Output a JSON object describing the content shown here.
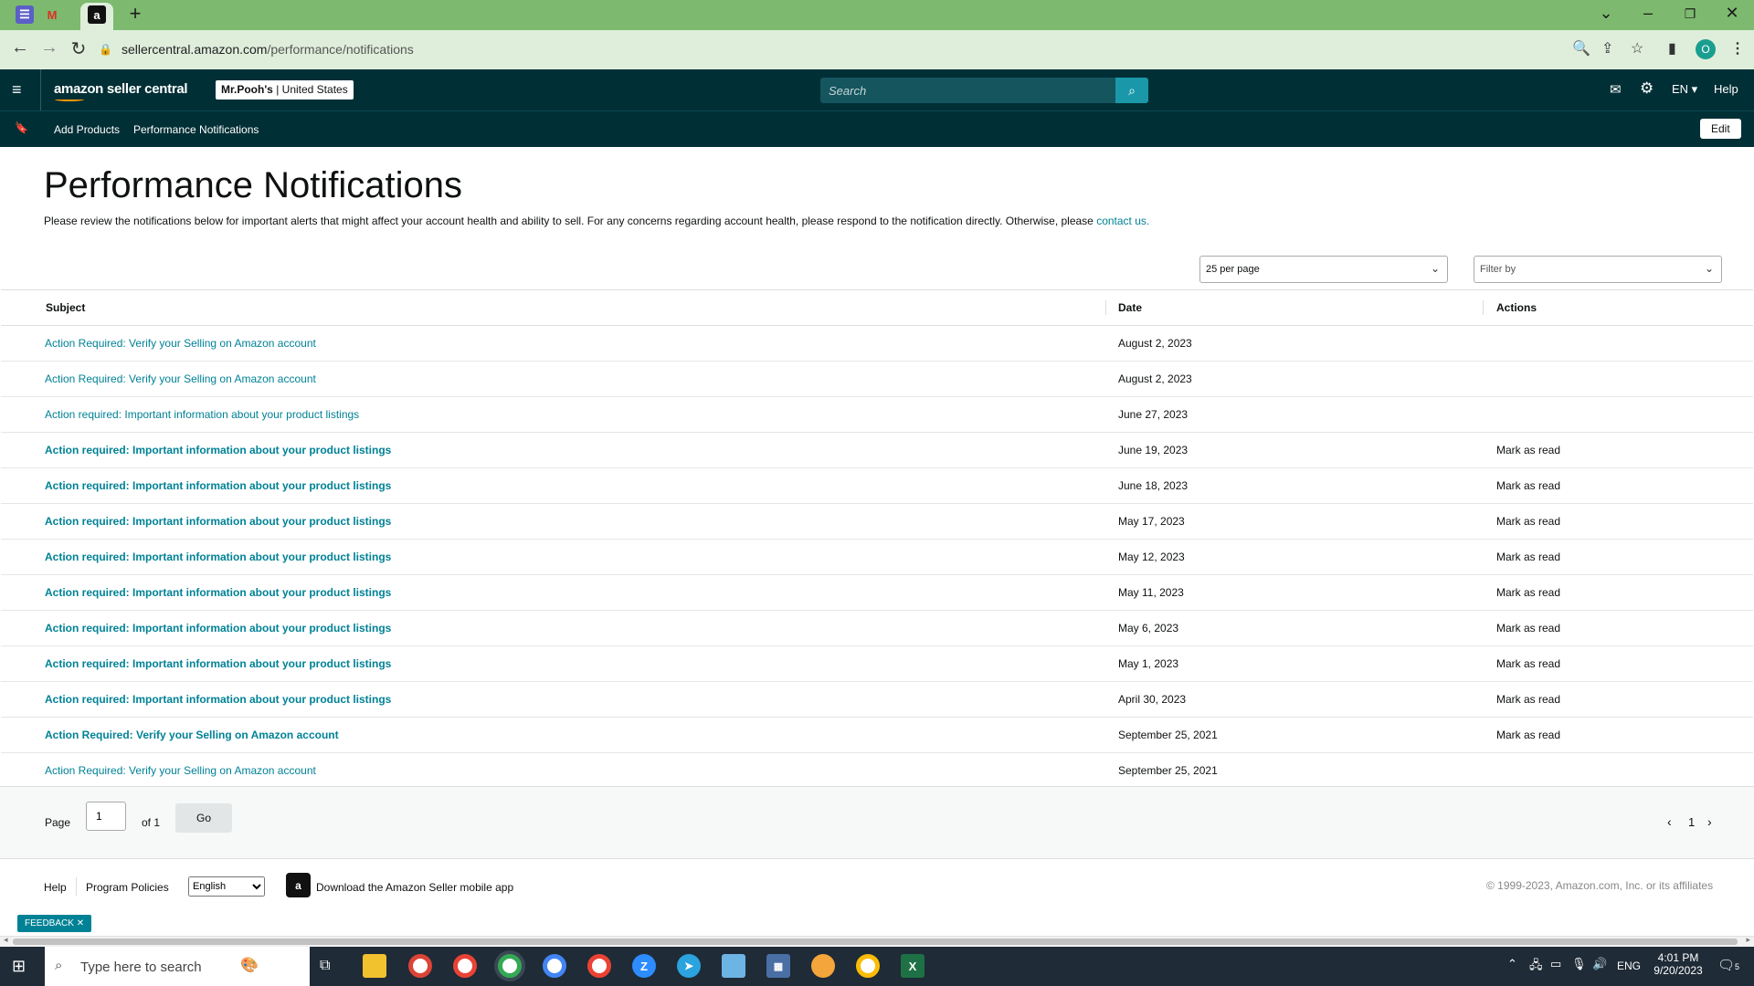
{
  "browser": {
    "url_domain": "sellercentral.amazon.com",
    "url_path": "/performance/notifications",
    "profile_initial": "O"
  },
  "header": {
    "logo_text": "amazon seller central",
    "store_name": "Mr.Pooh's",
    "store_region": "United States",
    "search_placeholder": "Search",
    "language": "EN",
    "help": "Help"
  },
  "subnav": {
    "items": [
      "Add Products",
      "Performance Notifications"
    ],
    "edit": "Edit"
  },
  "page": {
    "title": "Performance Notifications",
    "description": "Please review the notifications below for important alerts that might affect your account health and ability to sell. For any concerns regarding account health, please respond to the notification directly. Otherwise, please",
    "contact_link": "contact us.",
    "per_page": "25 per page",
    "filter_by": "Filter by"
  },
  "table": {
    "headers": [
      "Subject",
      "Date",
      "Actions"
    ],
    "rows": [
      {
        "subject": "Action Required: Verify your Selling on Amazon account",
        "date": "August 2, 2023",
        "action": "",
        "bold": false
      },
      {
        "subject": "Action Required: Verify your Selling on Amazon account",
        "date": "August 2, 2023",
        "action": "",
        "bold": false
      },
      {
        "subject": "Action required: Important information about your product listings",
        "date": "June 27, 2023",
        "action": "",
        "bold": false
      },
      {
        "subject": "Action required: Important information about your product listings",
        "date": "June 19, 2023",
        "action": "Mark as read",
        "bold": true
      },
      {
        "subject": "Action required: Important information about your product listings",
        "date": "June 18, 2023",
        "action": "Mark as read",
        "bold": true
      },
      {
        "subject": "Action required: Important information about your product listings",
        "date": "May 17, 2023",
        "action": "Mark as read",
        "bold": true
      },
      {
        "subject": "Action required: Important information about your product listings",
        "date": "May 12, 2023",
        "action": "Mark as read",
        "bold": true
      },
      {
        "subject": "Action required: Important information about your product listings",
        "date": "May 11, 2023",
        "action": "Mark as read",
        "bold": true
      },
      {
        "subject": "Action required: Important information about your product listings",
        "date": "May 6, 2023",
        "action": "Mark as read",
        "bold": true
      },
      {
        "subject": "Action required: Important information about your product listings",
        "date": "May 1, 2023",
        "action": "Mark as read",
        "bold": true
      },
      {
        "subject": "Action required: Important information about your product listings",
        "date": "April 30, 2023",
        "action": "Mark as read",
        "bold": true
      },
      {
        "subject": "Action Required: Verify your Selling on Amazon account",
        "date": "September 25, 2021",
        "action": "Mark as read",
        "bold": true
      },
      {
        "subject": "Action Required: Verify your Selling on Amazon account",
        "date": "September 25, 2021",
        "action": "",
        "bold": false
      }
    ]
  },
  "pager": {
    "page_label": "Page",
    "page_value": "1",
    "of_label": "of 1",
    "go": "Go",
    "current": "1"
  },
  "footer": {
    "help": "Help",
    "program_policies": "Program Policies",
    "language": "English",
    "download_app": "Download the Amazon Seller mobile app",
    "copyright": "© 1999-2023, Amazon.com, Inc. or its affiliates",
    "feedback": "FEEDBACK"
  },
  "taskbar": {
    "search_placeholder": "Type here to search",
    "lang": "ENG",
    "time": "4:01 PM",
    "date": "9/20/2023",
    "notification_count": "5"
  }
}
